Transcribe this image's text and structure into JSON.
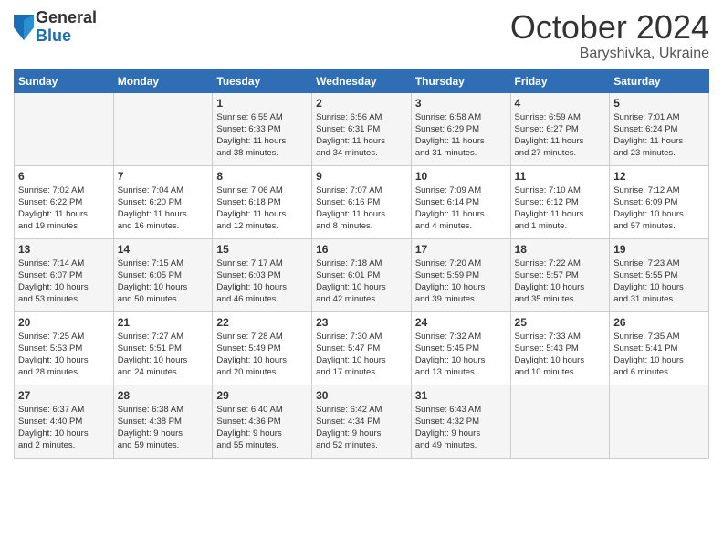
{
  "logo": {
    "general": "General",
    "blue": "Blue"
  },
  "header": {
    "month": "October 2024",
    "location": "Baryshivka, Ukraine"
  },
  "days_of_week": [
    "Sunday",
    "Monday",
    "Tuesday",
    "Wednesday",
    "Thursday",
    "Friday",
    "Saturday"
  ],
  "weeks": [
    [
      {
        "day": "",
        "info": ""
      },
      {
        "day": "",
        "info": ""
      },
      {
        "day": "1",
        "info": "Sunrise: 6:55 AM\nSunset: 6:33 PM\nDaylight: 11 hours\nand 38 minutes."
      },
      {
        "day": "2",
        "info": "Sunrise: 6:56 AM\nSunset: 6:31 PM\nDaylight: 11 hours\nand 34 minutes."
      },
      {
        "day": "3",
        "info": "Sunrise: 6:58 AM\nSunset: 6:29 PM\nDaylight: 11 hours\nand 31 minutes."
      },
      {
        "day": "4",
        "info": "Sunrise: 6:59 AM\nSunset: 6:27 PM\nDaylight: 11 hours\nand 27 minutes."
      },
      {
        "day": "5",
        "info": "Sunrise: 7:01 AM\nSunset: 6:24 PM\nDaylight: 11 hours\nand 23 minutes."
      }
    ],
    [
      {
        "day": "6",
        "info": "Sunrise: 7:02 AM\nSunset: 6:22 PM\nDaylight: 11 hours\nand 19 minutes."
      },
      {
        "day": "7",
        "info": "Sunrise: 7:04 AM\nSunset: 6:20 PM\nDaylight: 11 hours\nand 16 minutes."
      },
      {
        "day": "8",
        "info": "Sunrise: 7:06 AM\nSunset: 6:18 PM\nDaylight: 11 hours\nand 12 minutes."
      },
      {
        "day": "9",
        "info": "Sunrise: 7:07 AM\nSunset: 6:16 PM\nDaylight: 11 hours\nand 8 minutes."
      },
      {
        "day": "10",
        "info": "Sunrise: 7:09 AM\nSunset: 6:14 PM\nDaylight: 11 hours\nand 4 minutes."
      },
      {
        "day": "11",
        "info": "Sunrise: 7:10 AM\nSunset: 6:12 PM\nDaylight: 11 hours\nand 1 minute."
      },
      {
        "day": "12",
        "info": "Sunrise: 7:12 AM\nSunset: 6:09 PM\nDaylight: 10 hours\nand 57 minutes."
      }
    ],
    [
      {
        "day": "13",
        "info": "Sunrise: 7:14 AM\nSunset: 6:07 PM\nDaylight: 10 hours\nand 53 minutes."
      },
      {
        "day": "14",
        "info": "Sunrise: 7:15 AM\nSunset: 6:05 PM\nDaylight: 10 hours\nand 50 minutes."
      },
      {
        "day": "15",
        "info": "Sunrise: 7:17 AM\nSunset: 6:03 PM\nDaylight: 10 hours\nand 46 minutes."
      },
      {
        "day": "16",
        "info": "Sunrise: 7:18 AM\nSunset: 6:01 PM\nDaylight: 10 hours\nand 42 minutes."
      },
      {
        "day": "17",
        "info": "Sunrise: 7:20 AM\nSunset: 5:59 PM\nDaylight: 10 hours\nand 39 minutes."
      },
      {
        "day": "18",
        "info": "Sunrise: 7:22 AM\nSunset: 5:57 PM\nDaylight: 10 hours\nand 35 minutes."
      },
      {
        "day": "19",
        "info": "Sunrise: 7:23 AM\nSunset: 5:55 PM\nDaylight: 10 hours\nand 31 minutes."
      }
    ],
    [
      {
        "day": "20",
        "info": "Sunrise: 7:25 AM\nSunset: 5:53 PM\nDaylight: 10 hours\nand 28 minutes."
      },
      {
        "day": "21",
        "info": "Sunrise: 7:27 AM\nSunset: 5:51 PM\nDaylight: 10 hours\nand 24 minutes."
      },
      {
        "day": "22",
        "info": "Sunrise: 7:28 AM\nSunset: 5:49 PM\nDaylight: 10 hours\nand 20 minutes."
      },
      {
        "day": "23",
        "info": "Sunrise: 7:30 AM\nSunset: 5:47 PM\nDaylight: 10 hours\nand 17 minutes."
      },
      {
        "day": "24",
        "info": "Sunrise: 7:32 AM\nSunset: 5:45 PM\nDaylight: 10 hours\nand 13 minutes."
      },
      {
        "day": "25",
        "info": "Sunrise: 7:33 AM\nSunset: 5:43 PM\nDaylight: 10 hours\nand 10 minutes."
      },
      {
        "day": "26",
        "info": "Sunrise: 7:35 AM\nSunset: 5:41 PM\nDaylight: 10 hours\nand 6 minutes."
      }
    ],
    [
      {
        "day": "27",
        "info": "Sunrise: 6:37 AM\nSunset: 4:40 PM\nDaylight: 10 hours\nand 2 minutes."
      },
      {
        "day": "28",
        "info": "Sunrise: 6:38 AM\nSunset: 4:38 PM\nDaylight: 9 hours\nand 59 minutes."
      },
      {
        "day": "29",
        "info": "Sunrise: 6:40 AM\nSunset: 4:36 PM\nDaylight: 9 hours\nand 55 minutes."
      },
      {
        "day": "30",
        "info": "Sunrise: 6:42 AM\nSunset: 4:34 PM\nDaylight: 9 hours\nand 52 minutes."
      },
      {
        "day": "31",
        "info": "Sunrise: 6:43 AM\nSunset: 4:32 PM\nDaylight: 9 hours\nand 49 minutes."
      },
      {
        "day": "",
        "info": ""
      },
      {
        "day": "",
        "info": ""
      }
    ]
  ]
}
